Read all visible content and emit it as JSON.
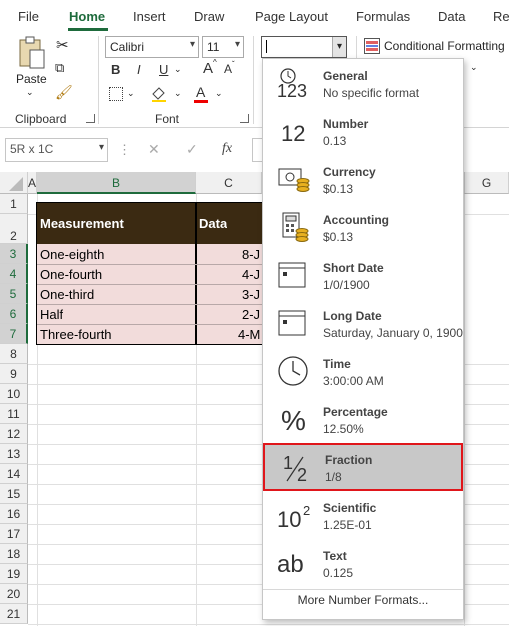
{
  "ribbon_tabs": [
    "File",
    "Home",
    "Insert",
    "Draw",
    "Page Layout",
    "Formulas",
    "Data",
    "Re"
  ],
  "ribbon": {
    "paste_label": "Paste",
    "clipboard_label": "Clipboard",
    "font_name": "Calibri",
    "font_size": "11",
    "font_label": "Font",
    "bold": "B",
    "italic": "I",
    "underline": "U",
    "grow_font": "A",
    "shrink_font": "A",
    "font_color_letter": "A",
    "number_format_value": "",
    "conditional_formatting": "Conditional Formatting"
  },
  "formula_bar": {
    "name_box": "5R x 1C",
    "fx": "fx"
  },
  "columns": [
    "A",
    "B",
    "C",
    "G"
  ],
  "rows": [
    "1",
    "2",
    "3",
    "4",
    "5",
    "6",
    "7",
    "8",
    "9",
    "10",
    "11",
    "12",
    "13",
    "14",
    "15",
    "16",
    "17",
    "18",
    "19",
    "20",
    "21"
  ],
  "table": {
    "headers": [
      "Measurement",
      "Data"
    ],
    "rows": [
      {
        "measurement": "One-eighth",
        "data": "8-J"
      },
      {
        "measurement": "One-fourth",
        "data": "4-J"
      },
      {
        "measurement": "One-third",
        "data": "3-J"
      },
      {
        "measurement": "Half",
        "data": "2-J"
      },
      {
        "measurement": "Three-fourth",
        "data": "4-M"
      }
    ]
  },
  "number_format_menu": {
    "items": [
      {
        "name": "General",
        "example": "No specific format",
        "icon": "general-123-icon"
      },
      {
        "name": "Number",
        "example": "0.13",
        "icon": "number-12-icon"
      },
      {
        "name": "Currency",
        "example": "$0.13",
        "icon": "currency-icon"
      },
      {
        "name": "Accounting",
        "example": " $0.13",
        "icon": "accounting-icon"
      },
      {
        "name": "Short Date",
        "example": "1/0/1900",
        "icon": "short-date-calendar-icon"
      },
      {
        "name": "Long Date",
        "example": "Saturday, January 0, 1900",
        "icon": "long-date-calendar-icon"
      },
      {
        "name": "Time",
        "example": "3:00:00 AM",
        "icon": "clock-icon"
      },
      {
        "name": "Percentage",
        "example": "12.50%",
        "icon": "percent-icon"
      },
      {
        "name": "Fraction",
        "example": " 1/8",
        "icon": "fraction-icon"
      },
      {
        "name": "Scientific",
        "example": "1.25E-01",
        "icon": "scientific-icon"
      },
      {
        "name": "Text",
        "example": "0.125",
        "icon": "text-ab-icon"
      }
    ],
    "icon_text": {
      "general": "123",
      "number": "12",
      "percent": "%",
      "fraction_num": "1",
      "fraction_den": "2",
      "sci_base": "10",
      "sci_exp": "2",
      "text": "ab"
    },
    "highlighted": "Fraction",
    "more_label": "More Number Formats..."
  },
  "colors": {
    "accent_green": "#1e6b3c",
    "header_fill": "#3b2a12",
    "data_fill": "#f2dcdb",
    "highlight_border": "#e0161b"
  }
}
